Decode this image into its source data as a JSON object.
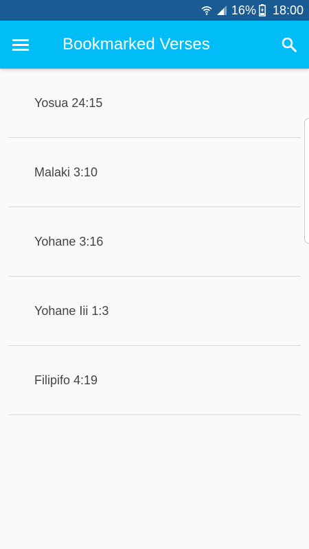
{
  "status_bar": {
    "battery_percent": "16%",
    "time": "18:00",
    "icons": [
      "wifi-icon",
      "signal-icon",
      "battery-icon"
    ]
  },
  "app_bar": {
    "title": "Bookmarked Verses",
    "menu_icon": "menu-icon",
    "search_icon": "search-icon",
    "background_color": "#00bdf7"
  },
  "bookmarks": [
    {
      "label": "Yosua 24:15"
    },
    {
      "label": "Malaki 3:10"
    },
    {
      "label": "Yohane 3:16"
    },
    {
      "label": "Yohane Iii 1:3"
    },
    {
      "label": "Filipifo 4:19"
    }
  ],
  "colors": {
    "status_bar": "#1b5b93",
    "app_bar": "#00bdf7",
    "background": "#fafafa",
    "text": "#444444",
    "divider": "#d9d9d9"
  }
}
